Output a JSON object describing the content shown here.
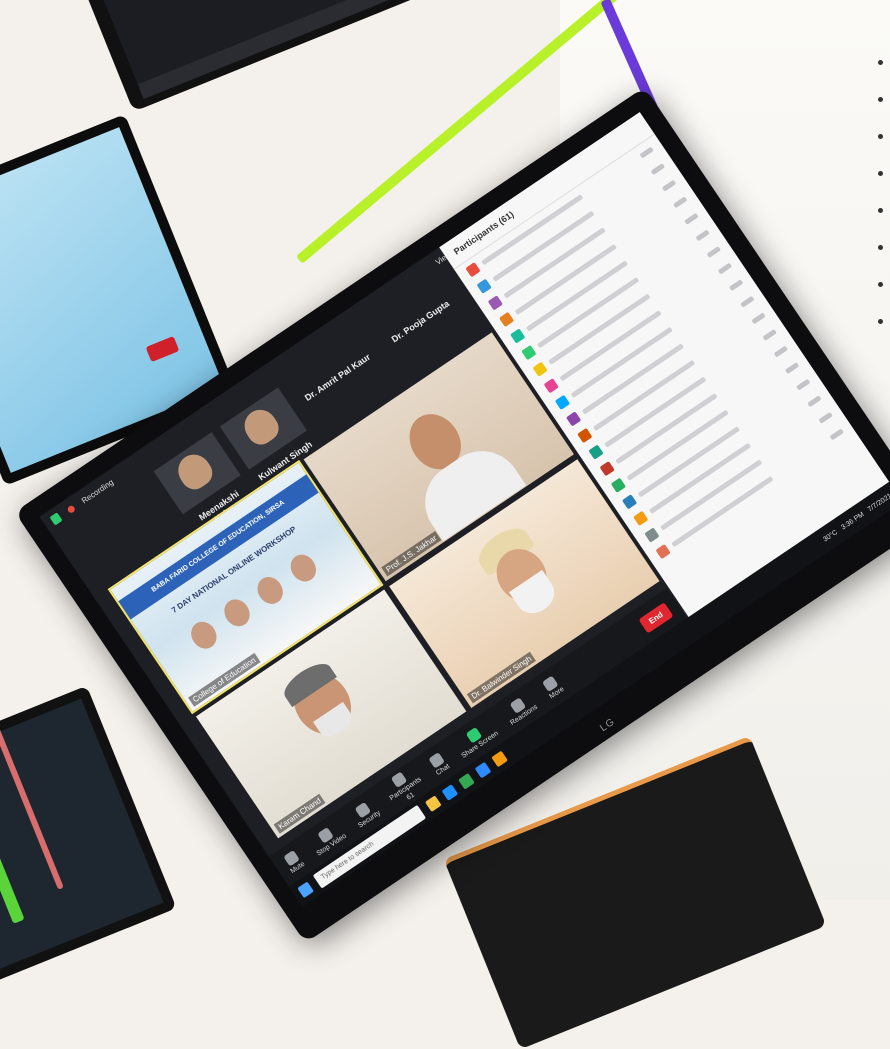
{
  "zoom": {
    "recording_label": "Recording",
    "view_label": "View",
    "thumbnails": [
      {
        "name": "Meenakshi Kalra"
      },
      {
        "name": "Kulwant Singh"
      }
    ],
    "top_names": [
      "Dr. Amrit Pal Kaur",
      "Dr. Pooja Gupta"
    ],
    "tiles": [
      {
        "name": "College of Education",
        "poster_band": "BABA FARID COLLEGE OF EDUCATION, SIRSA",
        "poster_sub": "7 DAY NATIONAL ONLINE WORKSHOP"
      },
      {
        "name": "Prof. J.S. Jakhar"
      },
      {
        "name": "Karam Chand"
      },
      {
        "name": "Dr. Balwinder Singh"
      }
    ],
    "toolbar": [
      {
        "label": "Mute",
        "icon": "microphone-icon"
      },
      {
        "label": "Stop Video",
        "icon": "camera-icon"
      },
      {
        "label": "Security",
        "icon": "shield-icon"
      },
      {
        "label": "Participants",
        "count": "61",
        "icon": "participants-icon"
      },
      {
        "label": "Chat",
        "icon": "chat-icon"
      },
      {
        "label": "Share Screen",
        "icon": "share-screen-icon"
      },
      {
        "label": "Reactions",
        "icon": "reactions-icon"
      },
      {
        "label": "More",
        "icon": "more-icon"
      }
    ],
    "end_label": "End"
  },
  "participants_panel": {
    "title": "Participants (61)",
    "rows": 18,
    "avatar_colors": [
      "#e74c3c",
      "#3498db",
      "#9b59b6",
      "#e67e22",
      "#1abc9c",
      "#2ecc71",
      "#f1c40f",
      "#e84393",
      "#00a8ff",
      "#8e44ad",
      "#d35400",
      "#16a085",
      "#c0392b",
      "#27ae60",
      "#2980b9",
      "#f39c12",
      "#7f8c8d",
      "#e17055"
    ]
  },
  "taskbar": {
    "search_placeholder": "Type here to search",
    "temperature": "30°C",
    "time": "3:36 PM",
    "date": "7/7/2021"
  },
  "monitor": {
    "brand": "LG"
  },
  "colors": {
    "accent_green": "#2ecc71",
    "end_red": "#e0262f"
  }
}
